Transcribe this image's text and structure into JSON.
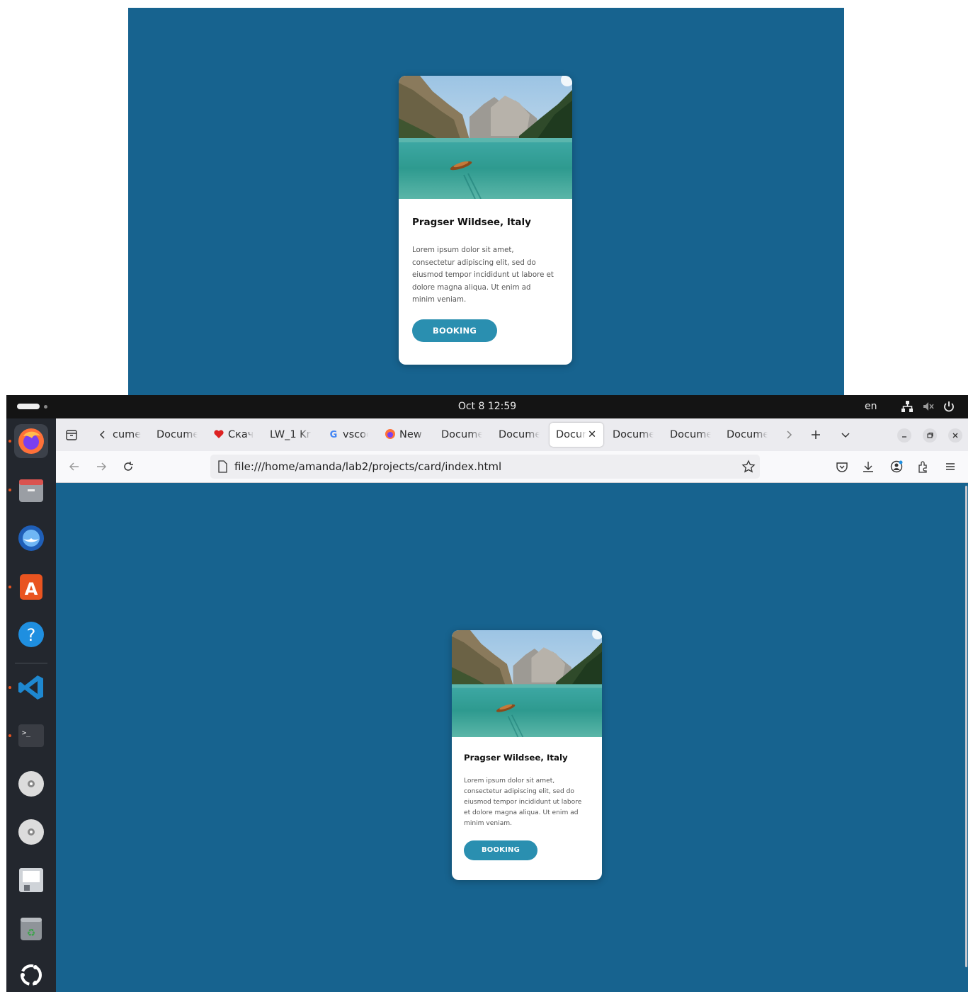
{
  "card": {
    "title": "Pragser Wildsee, Italy",
    "description": "Lorem ipsum dolor sit amet, consectetur adipiscing elit, sed do eiusmod tempor incididunt ut labore et dolore magna aliqua. Ut enim ad minim veniam.",
    "button_label": "BOOKING",
    "image_alt": "mountain-lake-photo"
  },
  "topbar": {
    "clock": "Oct 8  12:59",
    "language": "en"
  },
  "dock": {
    "apps": [
      "firefox-icon",
      "files-icon",
      "thunderbird-icon",
      "app-center-icon",
      "help-icon",
      "vscode-icon",
      "terminal-icon",
      "disc-icon",
      "disc-icon",
      "drive-icon",
      "trash-icon",
      "ubuntu-apps-icon"
    ]
  },
  "browser": {
    "tabs": [
      {
        "label": "cume"
      },
      {
        "label": "Docume"
      },
      {
        "label": "Скач"
      },
      {
        "label": "LW_1 Kr"
      },
      {
        "label": "vscoc"
      },
      {
        "label": "New"
      },
      {
        "label": "Docume"
      },
      {
        "label": "Docume"
      },
      {
        "label": "Docur"
      },
      {
        "label": "Docume"
      },
      {
        "label": "Docume"
      },
      {
        "label": "Docume"
      }
    ],
    "url": "file:///home/amanda/lab2/projects/card/index.html"
  },
  "colors": {
    "page_background": "#17638f",
    "button": "#2a8fb0",
    "card": "#ffffff"
  }
}
